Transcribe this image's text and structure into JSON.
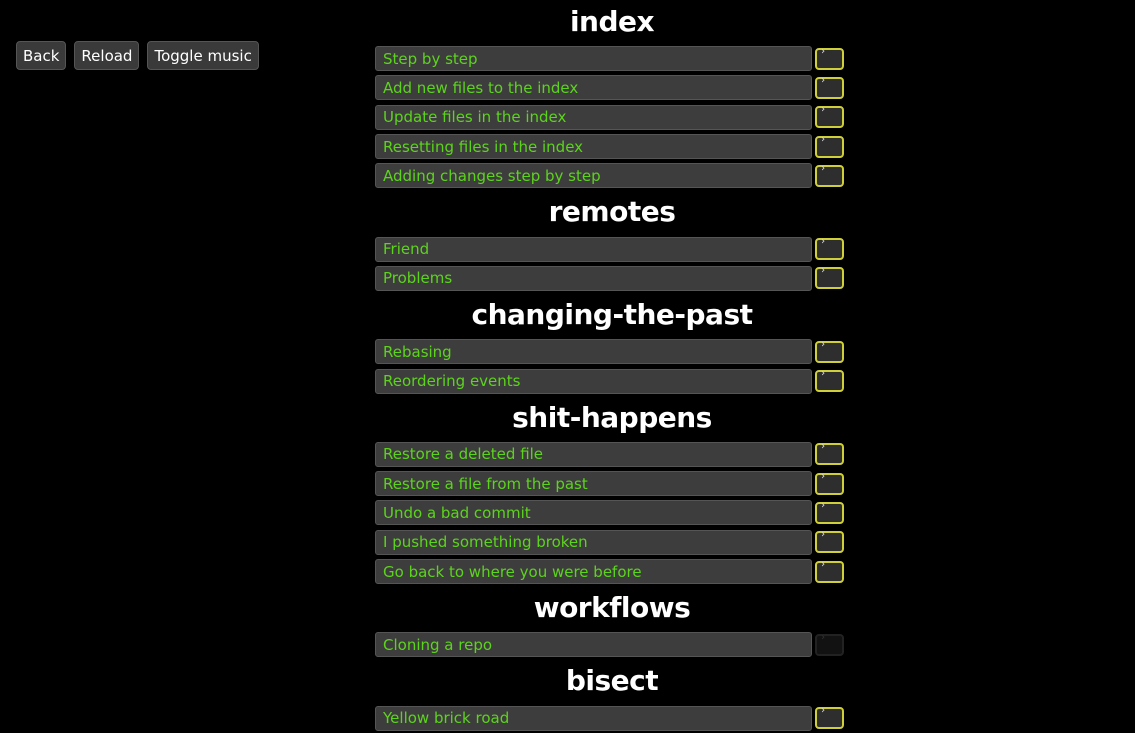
{
  "toolbar": {
    "back_label": "Back",
    "reload_label": "Reload",
    "music_label": "Toggle music"
  },
  "chapters": [
    {
      "title": "index",
      "levels": [
        {
          "label": "Step by step",
          "terminal_enabled": true
        },
        {
          "label": "Add new files to the index",
          "terminal_enabled": true
        },
        {
          "label": "Update files in the index",
          "terminal_enabled": true
        },
        {
          "label": "Resetting files in the index",
          "terminal_enabled": true
        },
        {
          "label": "Adding changes step by step",
          "terminal_enabled": true
        }
      ]
    },
    {
      "title": "remotes",
      "levels": [
        {
          "label": "Friend",
          "terminal_enabled": true
        },
        {
          "label": "Problems",
          "terminal_enabled": true
        }
      ]
    },
    {
      "title": "changing-the-past",
      "levels": [
        {
          "label": "Rebasing",
          "terminal_enabled": true
        },
        {
          "label": "Reordering events",
          "terminal_enabled": true
        }
      ]
    },
    {
      "title": "shit-happens",
      "levels": [
        {
          "label": "Restore a deleted file",
          "terminal_enabled": true
        },
        {
          "label": "Restore a file from the past",
          "terminal_enabled": true
        },
        {
          "label": "Undo a bad commit",
          "terminal_enabled": true
        },
        {
          "label": "I pushed something broken",
          "terminal_enabled": true
        },
        {
          "label": "Go back to where you were before",
          "terminal_enabled": true
        }
      ]
    },
    {
      "title": "workflows",
      "levels": [
        {
          "label": "Cloning a repo",
          "terminal_enabled": false
        }
      ]
    },
    {
      "title": "bisect",
      "levels": [
        {
          "label": "Yellow brick road",
          "terminal_enabled": true
        }
      ]
    }
  ],
  "terminal_icon_glyph": "›",
  "colors": {
    "background": "#000000",
    "level_text": "#5cd41c",
    "terminal_border": "#cfcf3a"
  }
}
